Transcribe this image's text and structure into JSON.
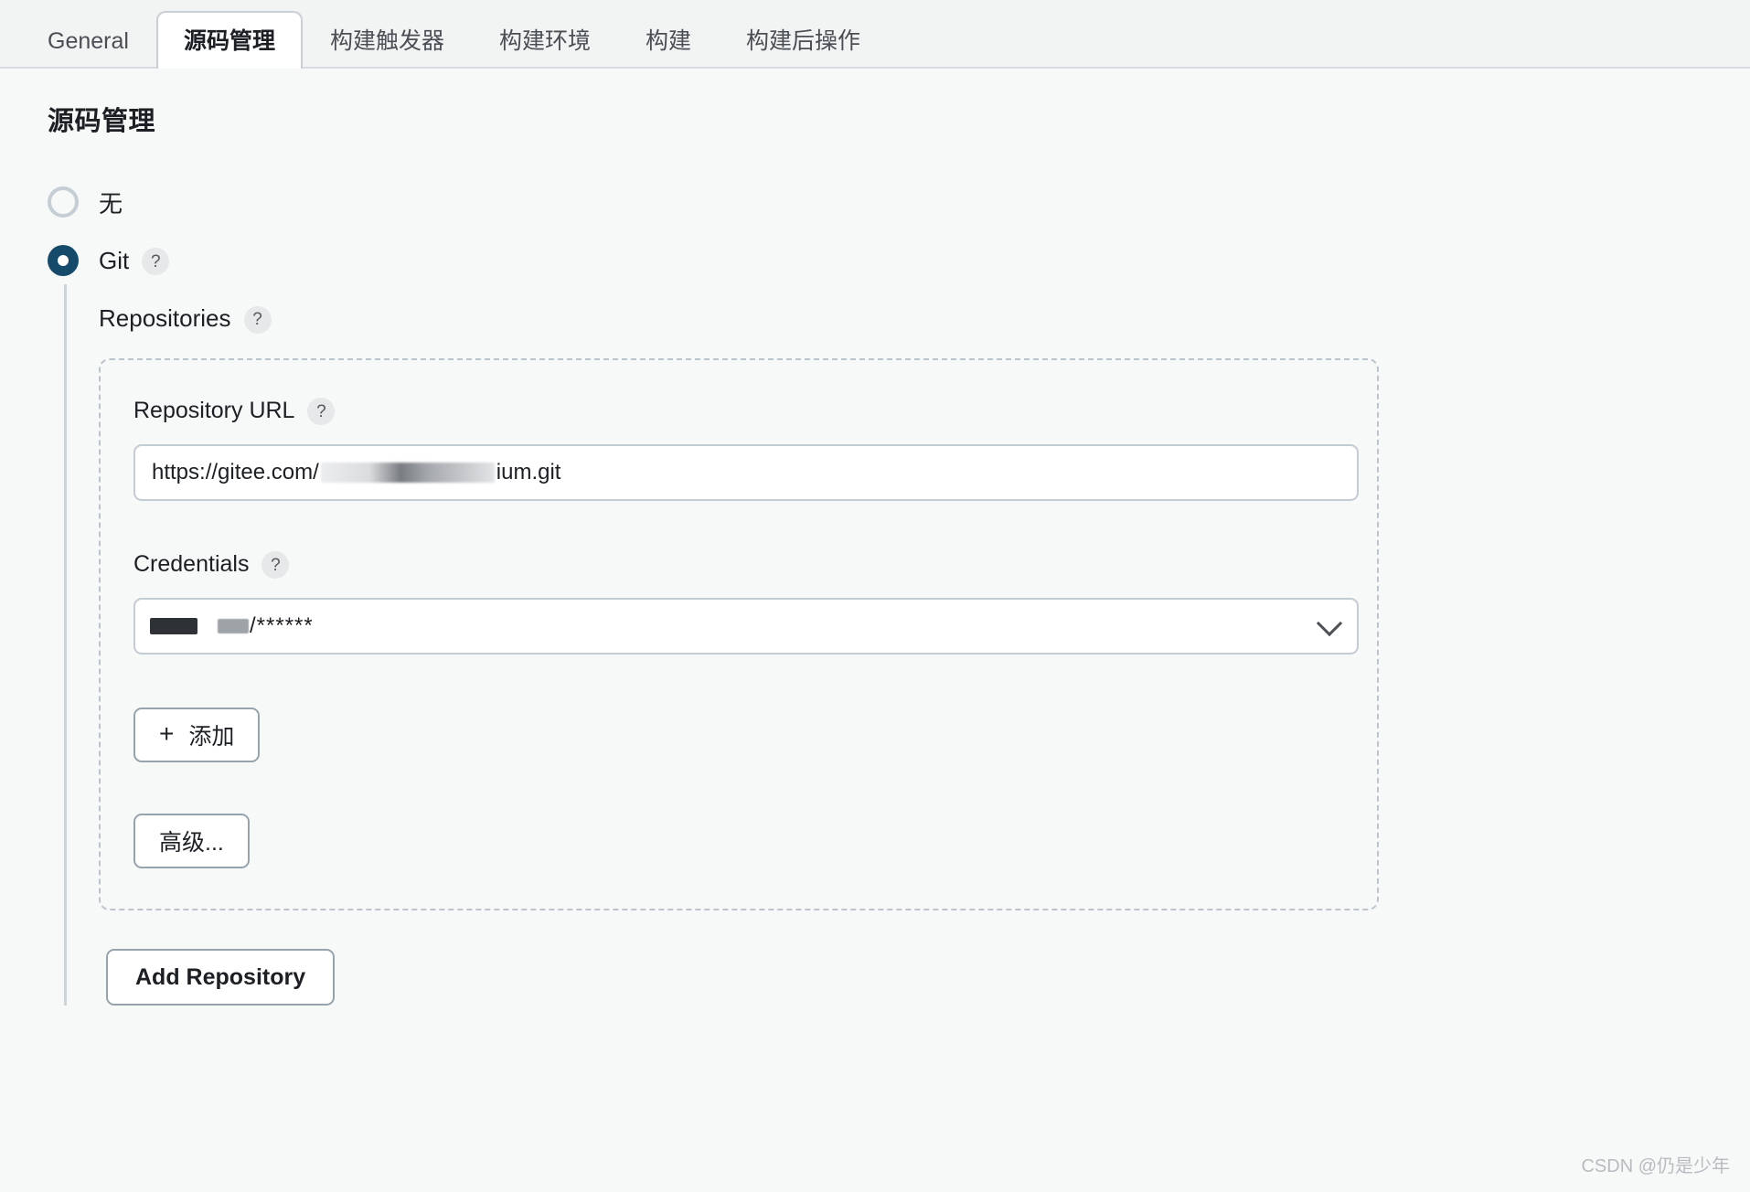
{
  "tabs": [
    {
      "label": "General",
      "active": false
    },
    {
      "label": "源码管理",
      "active": true
    },
    {
      "label": "构建触发器",
      "active": false
    },
    {
      "label": "构建环境",
      "active": false
    },
    {
      "label": "构建",
      "active": false
    },
    {
      "label": "构建后操作",
      "active": false
    }
  ],
  "page": {
    "title": "源码管理"
  },
  "scm": {
    "options": [
      {
        "label": "无",
        "selected": false
      },
      {
        "label": "Git",
        "selected": true,
        "help": "?"
      }
    ],
    "repositories_label": "Repositories",
    "repositories_help": "?"
  },
  "repository": {
    "url_label": "Repository URL",
    "url_help": "?",
    "url_prefix": "https://gitee.com/",
    "url_suffix": "ium.git",
    "url_redacted": true,
    "credentials_label": "Credentials",
    "credentials_help": "?",
    "credentials_value_stars": "/******",
    "credentials_redacted": true,
    "add_button": "添加",
    "add_button_icon": "plus-icon",
    "advanced_button": "高级..."
  },
  "actions": {
    "add_repository": "Add Repository"
  },
  "watermark": {
    "text": "CSDN @仍是少年"
  },
  "colors": {
    "page_background": "#f7f8f8",
    "tabbar_background": "#f2f3f3",
    "active_tab_background": "#ffffff",
    "radio_selected": "#154a6b",
    "radio_unselected_border": "#c5ced4",
    "dashed_border": "#b9c4cc",
    "input_border": "#c3ccd3",
    "button_border": "#97a3ac",
    "guide_line": "#ccd4da",
    "help_badge_background": "#e7e8e9",
    "text_primary": "#1c1f23",
    "watermark": "#b8bcc0"
  }
}
